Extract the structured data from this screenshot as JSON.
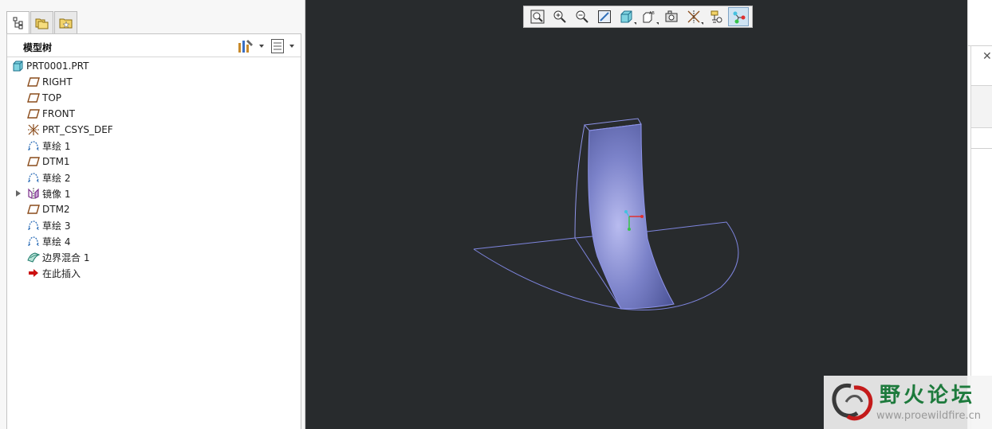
{
  "left_panel": {
    "tabs": [
      {
        "icon": "model-tree-icon",
        "active": true
      },
      {
        "icon": "folder-browser-icon",
        "active": false
      },
      {
        "icon": "favorites-icon",
        "active": false
      }
    ],
    "tree_title": "模型树",
    "header_tools": [
      {
        "icon": "tree-settings-icon"
      },
      {
        "icon": "tree-columns-icon"
      }
    ],
    "nodes": [
      {
        "label": "PRT0001.PRT",
        "icon": "part-icon"
      },
      {
        "label": "RIGHT",
        "icon": "datum-plane-icon"
      },
      {
        "label": "TOP",
        "icon": "datum-plane-icon"
      },
      {
        "label": "FRONT",
        "icon": "datum-plane-icon"
      },
      {
        "label": "PRT_CSYS_DEF",
        "icon": "csys-icon"
      },
      {
        "label": "草绘 1",
        "icon": "sketch-icon"
      },
      {
        "label": "DTM1",
        "icon": "datum-plane-icon"
      },
      {
        "label": "草绘 2",
        "icon": "sketch-icon"
      },
      {
        "label": "镜像 1",
        "icon": "mirror-icon"
      },
      {
        "label": "DTM2",
        "icon": "datum-plane-icon"
      },
      {
        "label": "草绘 3",
        "icon": "sketch-icon"
      },
      {
        "label": "草绘 4",
        "icon": "sketch-icon"
      },
      {
        "label": "边界混合 1",
        "icon": "boundary-blend-icon"
      },
      {
        "label": "在此插入",
        "icon": "insert-here-arrow-icon"
      }
    ]
  },
  "viewport": {
    "background_color": "#282b2d",
    "surface_color": "#7b82c9",
    "edge_color": "#7e85de",
    "toolbar": [
      {
        "icon": "refit-icon"
      },
      {
        "icon": "zoom-in-icon"
      },
      {
        "icon": "zoom-out-icon"
      },
      {
        "icon": "repaint-icon"
      },
      {
        "icon": "display-style-icon"
      },
      {
        "icon": "saved-orientations-icon"
      },
      {
        "icon": "view-manager-icon"
      },
      {
        "icon": "datum-display-icon"
      },
      {
        "icon": "annotation-display-icon"
      },
      {
        "icon": "spin-center-icon",
        "active": true
      }
    ]
  },
  "watermark": {
    "title": "野火论坛",
    "url": "www.proewildfire.cn"
  }
}
